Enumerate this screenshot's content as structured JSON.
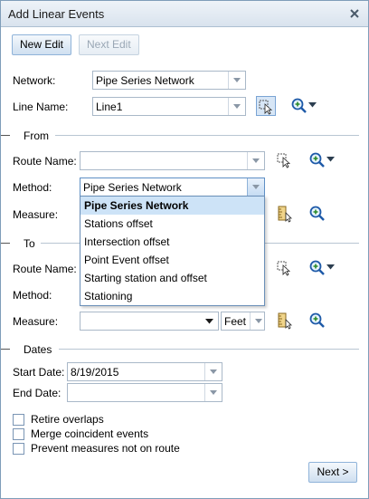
{
  "window": {
    "title": "Add Linear Events"
  },
  "toolbar": {
    "new_edit": "New Edit",
    "next_edit": "Next Edit"
  },
  "network": {
    "label": "Network:",
    "value": "Pipe Series Network"
  },
  "line_name": {
    "label": "Line Name:",
    "value": "Line1"
  },
  "from": {
    "heading": "From",
    "route_label": "Route Name:",
    "route_value": "",
    "method_label": "Method:",
    "method_value": "Pipe Series Network",
    "measure_label": "Measure:"
  },
  "method_dropdown": {
    "options": [
      "Pipe Series Network",
      "Stations offset",
      "Intersection offset",
      "Point Event offset",
      "Starting station and offset",
      "Stationing"
    ],
    "selected": "Pipe Series Network"
  },
  "to": {
    "heading": "To",
    "route_label": "Route Name:",
    "method_label": "Method:",
    "measure_label": "Measure:",
    "measure_value": "",
    "units_value": "Feet"
  },
  "dates": {
    "heading": "Dates",
    "start_label": "Start Date:",
    "start_value": "8/19/2015",
    "end_label": "End Date:",
    "end_value": ""
  },
  "options": {
    "retire_overlaps": "Retire overlaps",
    "merge_coincident": "Merge coincident events",
    "prevent_measures": "Prevent measures not on route"
  },
  "footer": {
    "next": "Next >"
  }
}
